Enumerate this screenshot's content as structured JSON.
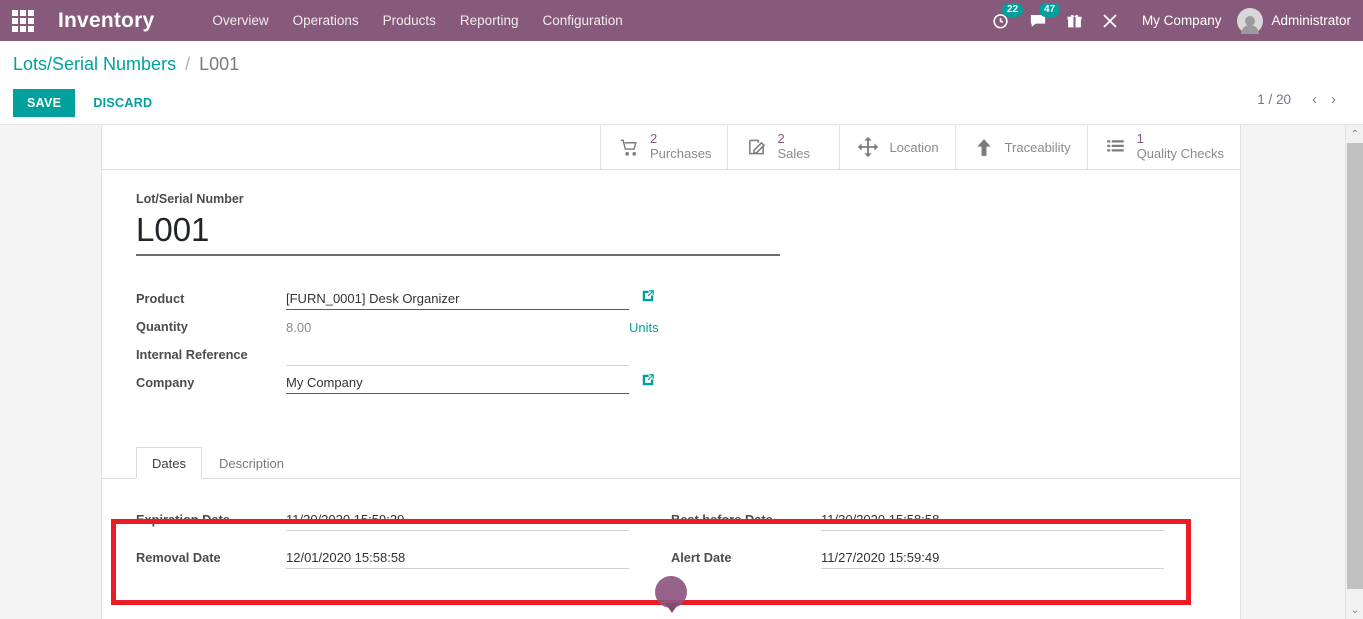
{
  "navbar": {
    "apps_icon": "apps-grid-icon",
    "brand": "Inventory",
    "menu": [
      {
        "label": "Overview"
      },
      {
        "label": "Operations"
      },
      {
        "label": "Products"
      },
      {
        "label": "Reporting"
      },
      {
        "label": "Configuration"
      }
    ],
    "activity_icon": "clock-activity-icon",
    "activity_count": "22",
    "messages_icon": "chat-bubble-icon",
    "messages_count": "47",
    "gift_icon": "gift-icon",
    "tools_icon": "wrench-tools-icon",
    "company": "My Company",
    "user": "Administrator",
    "accent_color": "#875A7B",
    "badge_color": "#00A09D"
  },
  "control_panel": {
    "breadcrumb_root": "Lots/Serial Numbers",
    "breadcrumb_separator": "/",
    "breadcrumb_current": "L001",
    "save_label": "SAVE",
    "discard_label": "DISCARD",
    "pager_count": "1 / 20",
    "pager_prev": "‹",
    "pager_next": "›",
    "primary_color": "#00A09D"
  },
  "stat_buttons": [
    {
      "icon": "shopping-cart-icon",
      "value": "2",
      "label": "Purchases"
    },
    {
      "icon": "pencil-square-icon",
      "value": "2",
      "label": "Sales"
    },
    {
      "icon": "arrows-move-icon",
      "value": "",
      "label": "Location"
    },
    {
      "icon": "arrow-up-icon",
      "value": "",
      "label": "Traceability"
    },
    {
      "icon": "list-icon",
      "value": "1",
      "label": "Quality Checks"
    }
  ],
  "form": {
    "title_label": "Lot/Serial Number",
    "title_value": "L001",
    "fields": {
      "product_label": "Product",
      "product_value": "[FURN_0001] Desk Organizer",
      "quantity_label": "Quantity",
      "quantity_value": "8.00",
      "quantity_uom": "Units",
      "internal_reference_label": "Internal Reference",
      "internal_reference_value": "",
      "company_label": "Company",
      "company_value": "My Company"
    },
    "external_link_icon": "external-link-icon",
    "dropdown_caret_icon": "chevron-down-icon"
  },
  "notebook": {
    "tabs": [
      {
        "label": "Dates",
        "active": true
      },
      {
        "label": "Description",
        "active": false
      }
    ],
    "dates": {
      "left": [
        {
          "label": "Expiration Date",
          "value": "11/30/2020 15:59:29"
        },
        {
          "label": "Removal Date",
          "value": "12/01/2020 15:58:58"
        }
      ],
      "right": [
        {
          "label": "Best before Date",
          "value": "11/30/2020 15:58:58"
        },
        {
          "label": "Alert Date",
          "value": "11/27/2020 15:59:49"
        }
      ]
    }
  },
  "annotation": {
    "highlight_color": "#ec1c24",
    "cursor_color": "#8e5680"
  },
  "scrollbar": {
    "up_arrow": "⌃",
    "down_arrow": "⌄"
  }
}
